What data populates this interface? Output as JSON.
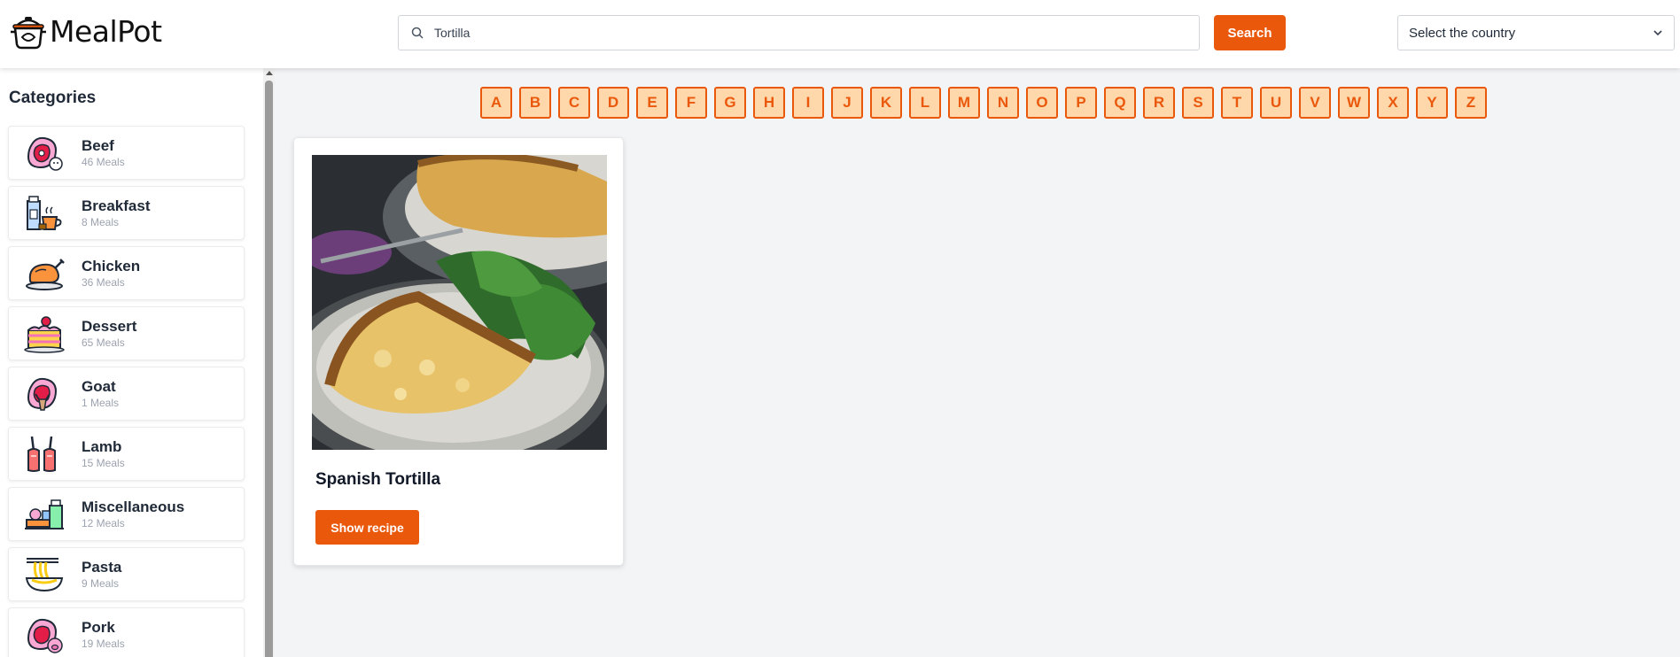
{
  "header": {
    "logo_text": "MealPot",
    "search_value": "Tortilla",
    "search_button": "Search",
    "country_placeholder": "Select the country"
  },
  "sidebar": {
    "title": "Categories",
    "items": [
      {
        "name": "Beef",
        "count": "46 Meals",
        "icon": "beef-icon"
      },
      {
        "name": "Breakfast",
        "count": "8 Meals",
        "icon": "breakfast-icon"
      },
      {
        "name": "Chicken",
        "count": "36 Meals",
        "icon": "chicken-icon"
      },
      {
        "name": "Dessert",
        "count": "65 Meals",
        "icon": "dessert-icon"
      },
      {
        "name": "Goat",
        "count": "1 Meals",
        "icon": "goat-icon"
      },
      {
        "name": "Lamb",
        "count": "15 Meals",
        "icon": "lamb-icon"
      },
      {
        "name": "Miscellaneous",
        "count": "12 Meals",
        "icon": "miscellaneous-icon"
      },
      {
        "name": "Pasta",
        "count": "9 Meals",
        "icon": "pasta-icon"
      },
      {
        "name": "Pork",
        "count": "19 Meals",
        "icon": "pork-icon"
      }
    ]
  },
  "letters": [
    "A",
    "B",
    "C",
    "D",
    "E",
    "F",
    "G",
    "H",
    "I",
    "J",
    "K",
    "L",
    "M",
    "N",
    "O",
    "P",
    "Q",
    "R",
    "S",
    "T",
    "U",
    "V",
    "W",
    "X",
    "Y",
    "Z"
  ],
  "meals": [
    {
      "title": "Spanish Tortilla",
      "button": "Show recipe"
    }
  ],
  "colors": {
    "accent": "#ea580c",
    "letter_bg": "#fed7aa"
  }
}
